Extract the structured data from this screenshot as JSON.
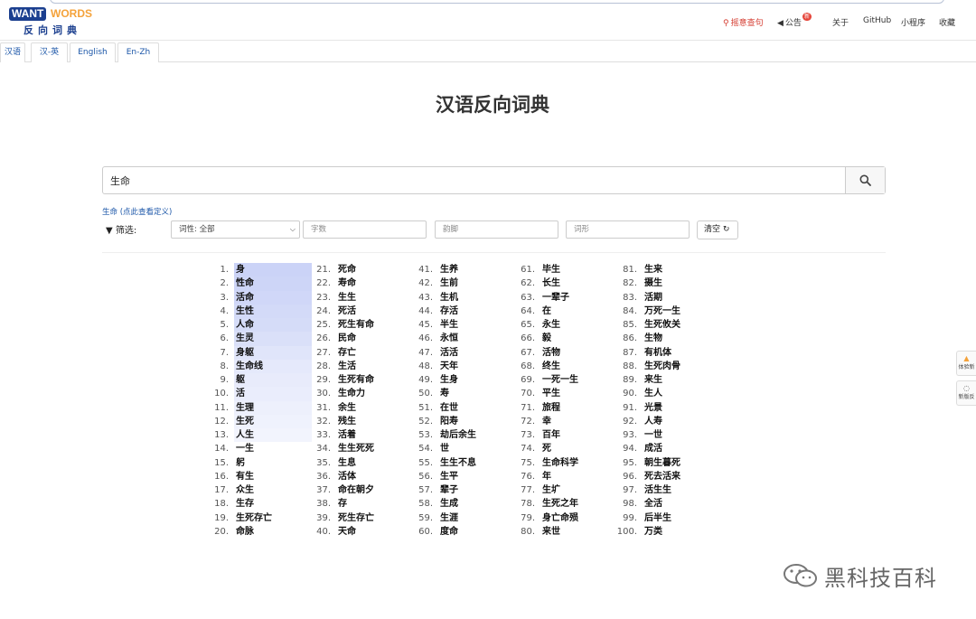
{
  "logo": {
    "want": "WANT",
    "words": "WORDS",
    "cn": "反向词典"
  },
  "nav": [
    {
      "label": "摇意查句",
      "icon": "search-icon"
    },
    {
      "label": "公告",
      "icon": "speaker-icon",
      "badge": "新"
    },
    {
      "label": "关于"
    },
    {
      "label": "GitHub"
    },
    {
      "label": "小程序"
    },
    {
      "label": "收藏"
    }
  ],
  "tabs": [
    "汉语",
    "汉-英",
    "English",
    "En-Zh"
  ],
  "title": "汉语反向词典",
  "search": {
    "value": "生命"
  },
  "defs_link": "生命 (点此查看定义)",
  "filter": {
    "label": "筛选:",
    "pos_select": "词性: 全部",
    "chars_placeholder": "字数",
    "rhyme_placeholder": "韵脚",
    "form_placeholder": "词形",
    "clear_label": "清空"
  },
  "results": [
    "身",
    "性命",
    "活命",
    "生性",
    "人命",
    "生灵",
    "身躯",
    "生命线",
    "躯",
    "活",
    "生理",
    "生死",
    "人生",
    "一生",
    "躬",
    "有生",
    "众生",
    "生存",
    "生死存亡",
    "命脉",
    "死命",
    "寿命",
    "生生",
    "死活",
    "死生有命",
    "民命",
    "存亡",
    "生活",
    "生死有命",
    "生命力",
    "余生",
    "残生",
    "活着",
    "生生死死",
    "生息",
    "活体",
    "命在朝夕",
    "存",
    "死生存亡",
    "天命",
    "生养",
    "生前",
    "生机",
    "存活",
    "半生",
    "永恒",
    "活活",
    "天年",
    "生身",
    "寿",
    "在世",
    "阳寿",
    "劫后余生",
    "世",
    "生生不息",
    "生平",
    "辈子",
    "生成",
    "生涯",
    "度命",
    "毕生",
    "长生",
    "一辈子",
    "在",
    "永生",
    "毅",
    "活物",
    "终生",
    "一死一生",
    "平生",
    "旅程",
    "幸",
    "百年",
    "死",
    "生命科学",
    "年",
    "生圹",
    "生死之年",
    "身亡命殒",
    "来世",
    "生来",
    "摄生",
    "活期",
    "万死一生",
    "生死攸关",
    "生物",
    "有机体",
    "生死肉骨",
    "来生",
    "生人",
    "光景",
    "人寿",
    "一世",
    "成活",
    "朝生暮死",
    "死去活来",
    "活生生",
    "全活",
    "后半生",
    "万类"
  ],
  "highlight_levels": [
    1.0,
    0.95,
    0.9,
    0.85,
    0.8,
    0.7,
    0.6,
    0.5,
    0.45,
    0.4,
    0.35,
    0.3,
    0.25
  ],
  "side": [
    "体验新",
    "新版反"
  ],
  "watermark": "黑科技百科",
  "colors": {
    "brand": "#1b3f8f",
    "accent": "#f4a23a",
    "link": "#1b56a8",
    "highlight": "#c7d0f7"
  }
}
